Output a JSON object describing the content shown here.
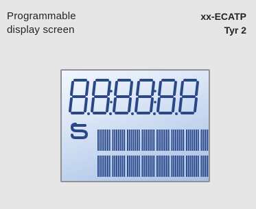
{
  "card": {
    "title_line1": "Programmable",
    "title_line2": "display screen",
    "model_line1": "xx-ECATP",
    "model_line2": "Tyr 2"
  },
  "display": {
    "digit_count": 6,
    "matrix_rows": 2,
    "matrix_chars_per_row": 8,
    "colors": {
      "segment": "#2a4789",
      "background_light": "#f2f7fd",
      "background_dark": "#a9c0e3"
    },
    "icons": [
      "sauter-logo-icon"
    ]
  }
}
